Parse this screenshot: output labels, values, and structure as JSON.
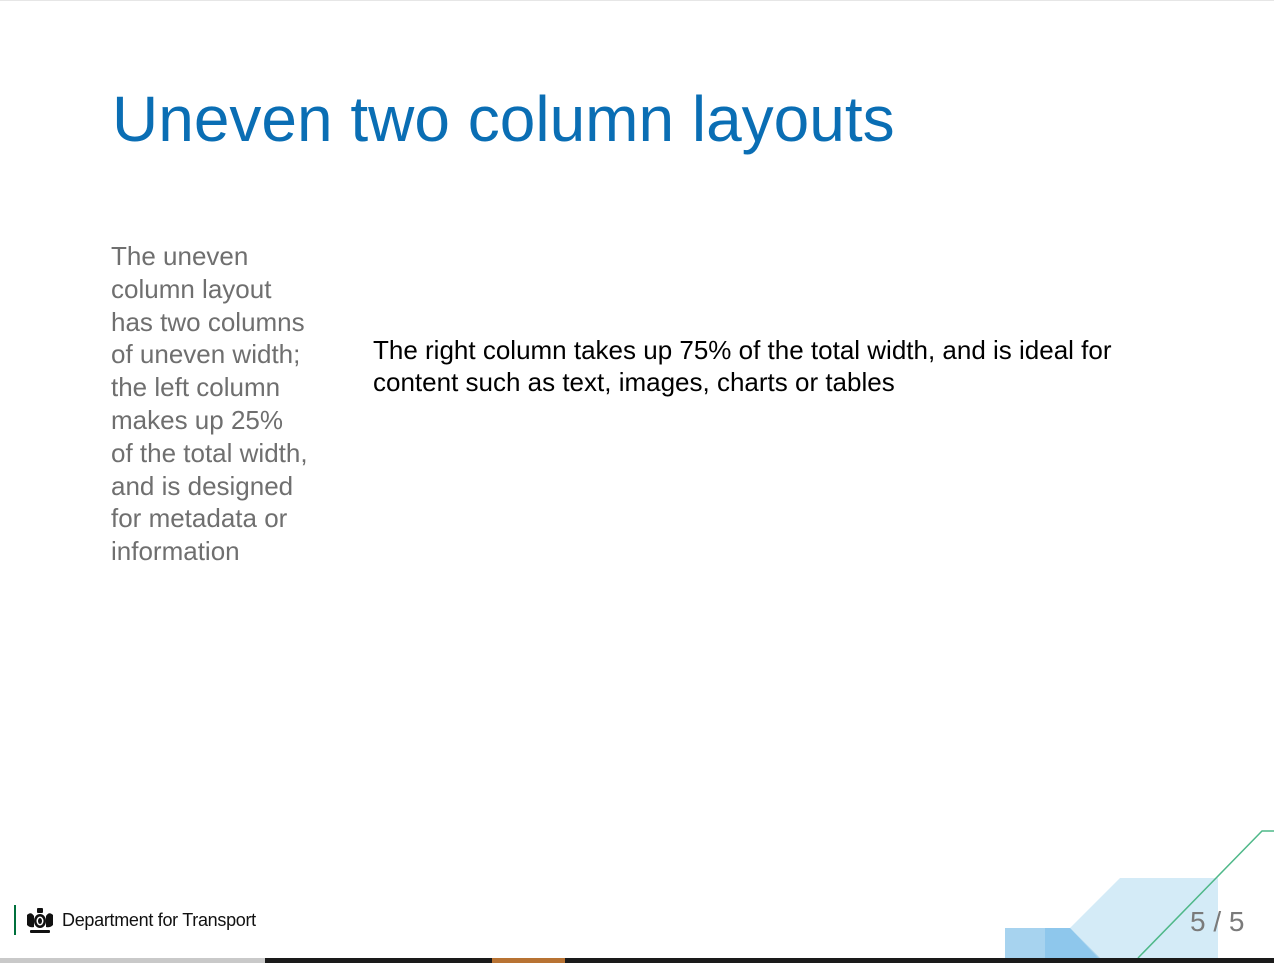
{
  "slide": {
    "title": "Uneven two column layouts",
    "left_column_text": "The uneven column layout has two columns of uneven width; the left column makes up 25% of the total width, and is designed for metadata or information",
    "right_column_text": "The right column takes up 75% of the total width, and is ideal for content such as text, images, charts or tables",
    "page_number": "5 / 5"
  },
  "footer": {
    "organisation": "Department for Transport",
    "crest_icon": "royal-crest-icon"
  },
  "colors": {
    "title": "#0a6eb4",
    "left_text": "#6f6f6f",
    "right_text": "#000000",
    "page_number": "#7a7a7a",
    "brand_green": "#00703c",
    "decor_light_blue": "#d4ebf7",
    "decor_mid_blue": "#a7d3ef",
    "decor_deep_blue": "#8ec7ec",
    "decor_line_green": "#4fb889",
    "bar_dark": "#1a1a1a",
    "bar_gray": "#c9c9c9",
    "bar_orange": "#b87333"
  }
}
